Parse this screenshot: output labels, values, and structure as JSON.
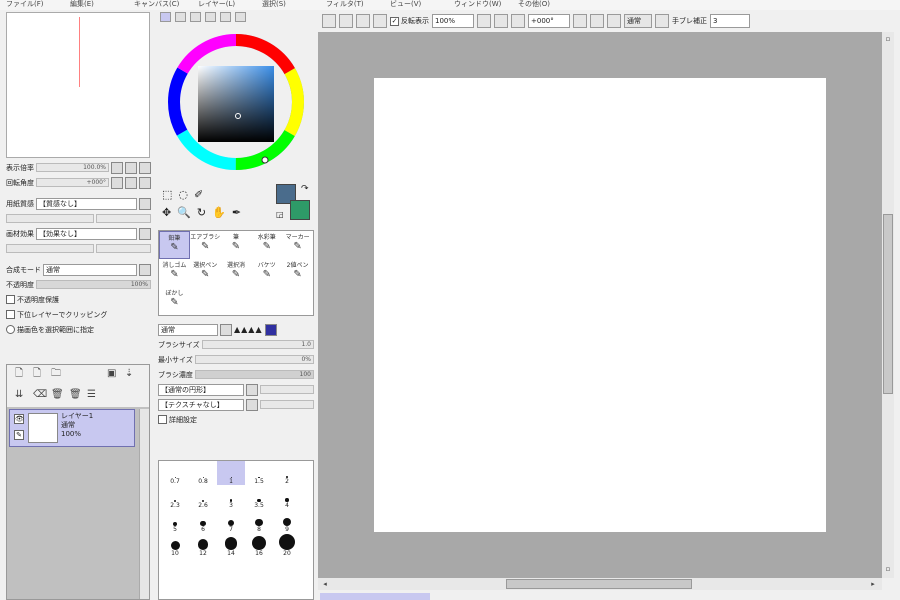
{
  "menu": [
    "ファイル(F)",
    "編集(E)",
    "キャンバス(C)",
    "レイヤー(L)",
    "選択(S)",
    "フィルタ(T)",
    "ビュー(V)",
    "ウィンドウ(W)",
    "その他(O)"
  ],
  "toolbar": {
    "flip_label": "反転表示",
    "zoom": "100%",
    "angle": "+000°",
    "rotate_reset": "通常",
    "stabilizer_label": "手ブレ補正",
    "stabilizer_value": "3"
  },
  "navigator": {
    "zoom_label": "表示倍率",
    "zoom_value": "100.0%",
    "angle_label": "回転角度",
    "angle_value": "+000°"
  },
  "paper_panel": {
    "texture_label": "用紙質感",
    "texture_value": "【質感なし】",
    "effect_label": "画材効果",
    "effect_value": "【効果なし】"
  },
  "layer_props": {
    "blend_label": "合成モード",
    "blend_value": "通常",
    "opacity_label": "不透明度",
    "opacity_value": "100%",
    "clip_label": "下位レイヤーでクリッピング",
    "protect_label": "不透明度保護",
    "select_label": "描画色を選択範囲に指定"
  },
  "layer": {
    "name": "レイヤー1",
    "mode": "通常",
    "opacity": "100%"
  },
  "tools": [
    {
      "label": "鉛筆",
      "icon": "pencil-icon"
    },
    {
      "label": "エアブラシ",
      "icon": "airbrush-icon"
    },
    {
      "label": "筆",
      "icon": "brush-icon"
    },
    {
      "label": "水彩筆",
      "icon": "watercolor-icon"
    },
    {
      "label": "マーカー",
      "icon": "marker-icon"
    },
    {
      "label": "消しゴム",
      "icon": "eraser-icon"
    },
    {
      "label": "選択ペン",
      "icon": "select-pen-icon"
    },
    {
      "label": "選択消",
      "icon": "select-erase-icon"
    },
    {
      "label": "バケツ",
      "icon": "bucket-icon"
    },
    {
      "label": "2値ペン",
      "icon": "binary-pen-icon"
    },
    {
      "label": "ぼかし",
      "icon": "blur-icon"
    }
  ],
  "brush": {
    "shape_label": "通常",
    "size_label": "ブラシサイズ",
    "size_value": "1.0",
    "min_label": "最小サイズ",
    "min_value": "0%",
    "density_label": "ブラシ濃度",
    "density_value": "100",
    "shape1": "【通常の円形】",
    "shape2": "【テクスチャなし】",
    "detail_label": "詳細設定"
  },
  "brush_sizes": [
    "0.7",
    "0.8",
    "1",
    "1.5",
    "2",
    "2.3",
    "2.6",
    "3",
    "3.5",
    "4",
    "5",
    "6",
    "7",
    "8",
    "9",
    "10",
    "12",
    "14",
    "16",
    "20"
  ],
  "colors": {
    "main": "#4a6c8c",
    "sub": "#2e9a68",
    "accent": "#c8c8f0"
  }
}
